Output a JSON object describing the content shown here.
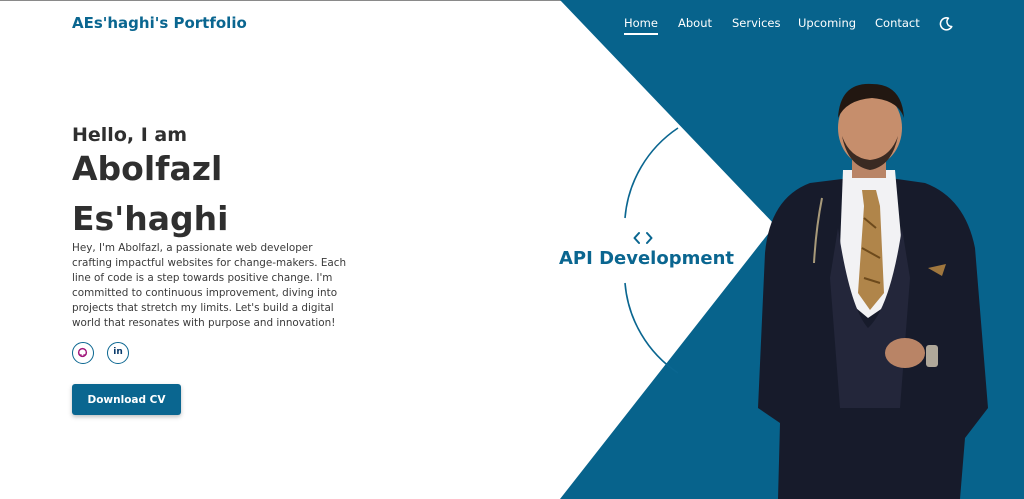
{
  "brand": {
    "title": "AEs'haghi's Portfolio",
    "color": "#0a6690"
  },
  "nav": {
    "items": [
      {
        "label": "Home",
        "active": true
      },
      {
        "label": "About",
        "active": false
      },
      {
        "label": "Services",
        "active": false
      },
      {
        "label": "Upcoming",
        "active": false
      },
      {
        "label": "Contact",
        "active": false
      }
    ],
    "theme_icon": "moon-icon"
  },
  "hero": {
    "greeting": "Hello, I am",
    "name_line1": "Abolfazl",
    "name_line2": "Es'haghi",
    "description": "Hey, I'm Abolfazl, a passionate web developer crafting impactful websites for change-makers. Each line of code is a step towards positive change. I'm committed to continuous improvement, diving into projects that stretch my limits. Let's build a digital world that resonates with purpose and innovation!",
    "social": [
      {
        "name": "github",
        "icon": "github-icon"
      },
      {
        "name": "linkedin",
        "icon": "linkedin-icon",
        "text": "in"
      }
    ],
    "cta_label": "Download CV"
  },
  "service": {
    "icon": "code-icon",
    "label": "API Development"
  },
  "colors": {
    "accent": "#0a6690",
    "background": "#ffffff",
    "text": "#2f2f2f"
  }
}
